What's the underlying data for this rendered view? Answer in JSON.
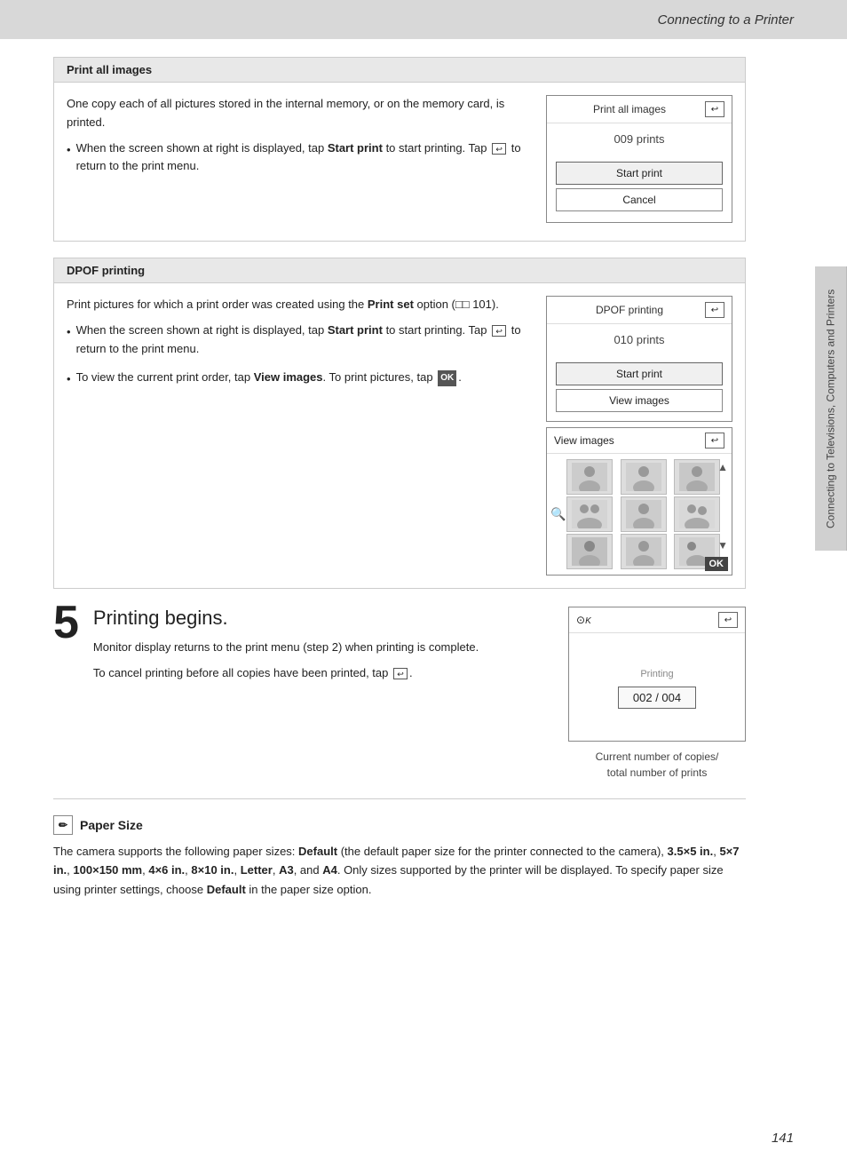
{
  "header": {
    "title": "Connecting to a Printer"
  },
  "side_tab": {
    "text": "Connecting to Televisions, Computers and Printers"
  },
  "sections": [
    {
      "id": "print-all-images",
      "title": "Print all images",
      "description": "One copy each of all pictures stored in the internal memory, or on the memory card, is printed.",
      "bullet": "When the screen shown at right is displayed, tap Start print to start printing. Tap  to return to the print menu.",
      "screen": {
        "title": "Print all images",
        "prints": "009 prints",
        "buttons": [
          "Start print",
          "Cancel"
        ]
      }
    },
    {
      "id": "dpof-printing",
      "title": "DPOF printing",
      "description": "Print pictures for which a print order was created using the Print set option (□02 101).",
      "bullet": "When the screen shown at right is displayed, tap Start print to start printing. Tap  to return to the print menu.",
      "extra_bullet": "To view the current print order, tap View images. To print pictures, tap OK.",
      "screen": {
        "title": "DPOF printing",
        "prints": "010 prints",
        "buttons": [
          "Start print",
          "View images"
        ]
      },
      "view_images_screen": {
        "title": "View images"
      }
    }
  ],
  "step5": {
    "number": "5",
    "title": "Printing begins.",
    "text1": "Monitor display returns to the print menu (step 2) when printing is complete.",
    "text2": "To cancel printing before all copies have been printed, tap",
    "screen": {
      "printing_label": "Printing",
      "progress": "002 / 004"
    },
    "caption": "Current number of copies/\ntotal number of prints"
  },
  "paper_size": {
    "title": "Paper Size",
    "text": "The camera supports the following paper sizes: Default (the default paper size for the printer connected to the camera), 3.5×5 in., 5×7 in., 100×150 mm, 4×6 in., 8×10 in., Letter, A3, and A4. Only sizes supported by the printer will be displayed. To specify paper size using printer settings, choose Default in the paper size option."
  },
  "page_number": "141"
}
